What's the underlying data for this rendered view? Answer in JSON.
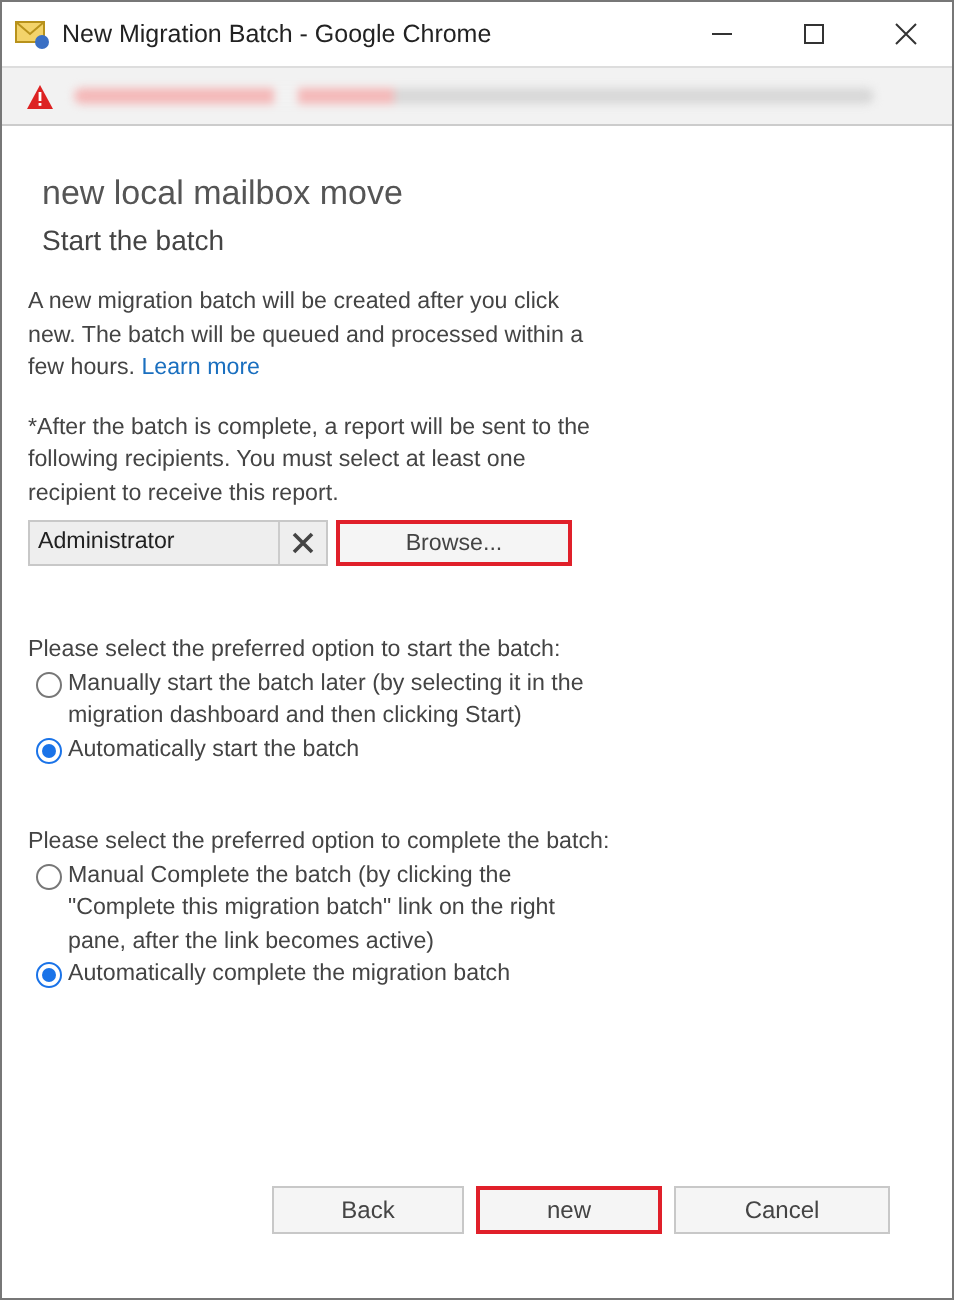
{
  "window": {
    "title": "New Migration Batch - Google Chrome"
  },
  "heading": "new local mailbox move",
  "subheading": "Start the batch",
  "intro": {
    "text": "A new migration batch will be created after you click new. The batch will be queued and processed within a few hours.",
    "link": "Learn more"
  },
  "recipients": {
    "note": "*After the batch is complete, a report will be sent to the following recipients. You must select at least one recipient to receive this report.",
    "value": "Administrator",
    "browse": {
      "label": "Browse...",
      "highlighted": true
    }
  },
  "start_options": {
    "prompt": "Please select the preferred option to start the batch:",
    "options": [
      {
        "label": "Manually start the batch later (by selecting it in the migration dashboard and then clicking Start)",
        "selected": false
      },
      {
        "label": "Automatically start the batch",
        "selected": true
      }
    ]
  },
  "complete_options": {
    "prompt": "Please select the preferred option to complete the batch:",
    "options": [
      {
        "label": "Manual Complete the batch (by clicking the \"Complete this migration batch\" link on the right pane, after the link becomes active)",
        "selected": false
      },
      {
        "label": "Automatically complete the migration batch",
        "selected": true
      }
    ]
  },
  "buttons": [
    {
      "label": "Back",
      "highlighted": false
    },
    {
      "label": "new",
      "highlighted": true
    },
    {
      "label": "Cancel",
      "highlighted": false
    }
  ]
}
